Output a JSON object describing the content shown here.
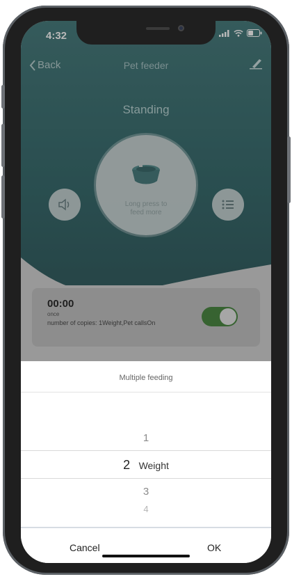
{
  "status": {
    "time": "4:32"
  },
  "nav": {
    "back_label": "Back",
    "title": "Pet feeder"
  },
  "device": {
    "state": "Standing",
    "feed_hint_line1": "Long press to",
    "feed_hint_line2": "feed more"
  },
  "schedule": {
    "time": "00:00",
    "frequency": "once",
    "copies_label": "number of copies:",
    "copies_value": "1Weight,Pet callsOn",
    "enabled": true
  },
  "sheet": {
    "title": "Multiple feeding",
    "options": [
      "1",
      "2",
      "3",
      "4"
    ],
    "selected_value": "2",
    "selected_unit": "Weight",
    "cancel_label": "Cancel",
    "ok_label": "OK"
  },
  "colors": {
    "accent_green": "#4d8a44",
    "teal": "#3b6e70"
  }
}
